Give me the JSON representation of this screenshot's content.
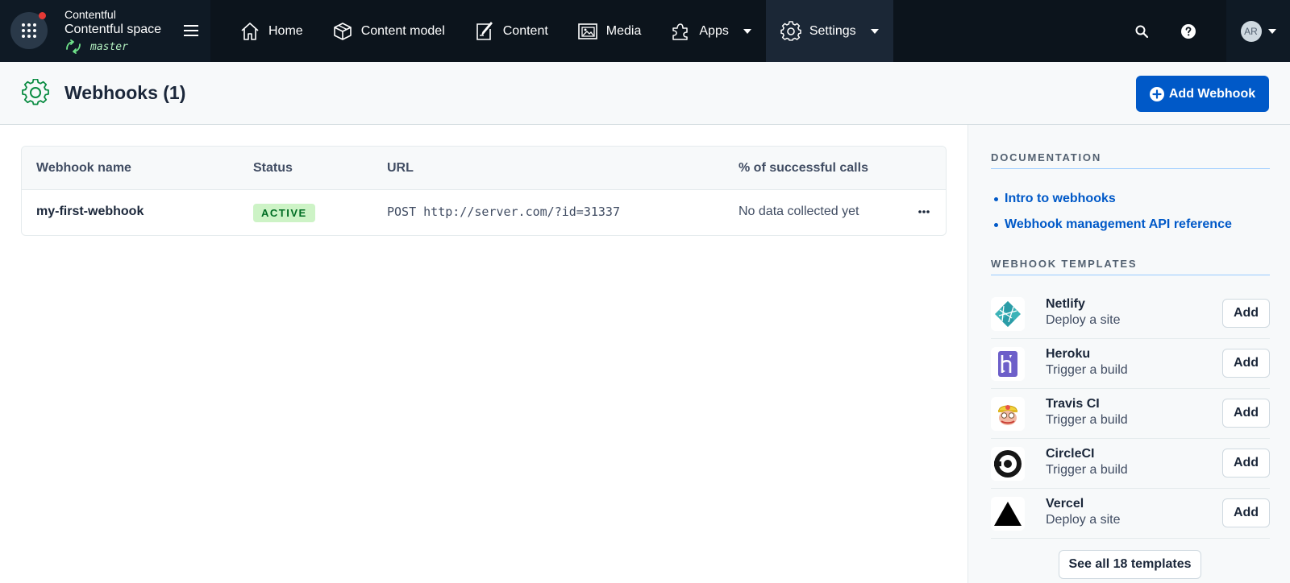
{
  "topbar": {
    "org_name": "Contentful",
    "space_name": "Contentful space",
    "environment": "master",
    "nav": [
      {
        "label": "Home",
        "icon": "home-icon"
      },
      {
        "label": "Content model",
        "icon": "content-model-icon"
      },
      {
        "label": "Content",
        "icon": "content-icon"
      },
      {
        "label": "Media",
        "icon": "media-icon"
      },
      {
        "label": "Apps",
        "icon": "apps-icon"
      },
      {
        "label": "Settings",
        "icon": "gear-icon"
      }
    ],
    "avatar_initials": "AR"
  },
  "page": {
    "title": "Webhooks (1)",
    "add_button_label": "Add Webhook"
  },
  "table": {
    "columns": [
      "Webhook name",
      "Status",
      "URL",
      "% of successful calls"
    ],
    "rows": [
      {
        "name": "my-first-webhook",
        "status": "ACTIVE",
        "url": "POST http://server.com/?id=31337",
        "success": "No data collected yet"
      }
    ]
  },
  "sidebar": {
    "documentation_heading": "DOCUMENTATION",
    "links": [
      "Intro to webhooks",
      "Webhook management API reference"
    ],
    "templates_heading": "WEBHOOK TEMPLATES",
    "templates": [
      {
        "name": "Netlify",
        "desc": "Deploy a site",
        "add": "Add",
        "icon": "netlify-logo-icon"
      },
      {
        "name": "Heroku",
        "desc": "Trigger a build",
        "add": "Add",
        "icon": "heroku-logo-icon"
      },
      {
        "name": "Travis CI",
        "desc": "Trigger a build",
        "add": "Add",
        "icon": "travis-ci-logo-icon"
      },
      {
        "name": "CircleCI",
        "desc": "Trigger a build",
        "add": "Add",
        "icon": "circleci-logo-icon"
      },
      {
        "name": "Vercel",
        "desc": "Deploy a site",
        "add": "Add",
        "icon": "vercel-logo-icon"
      }
    ],
    "see_all_label": "See all 18 templates"
  },
  "colors": {
    "topbar_bg": "#0c141c",
    "primary": "#0059c8",
    "active_badge_bg": "#cdf3c6",
    "active_badge_text": "#006d23"
  }
}
